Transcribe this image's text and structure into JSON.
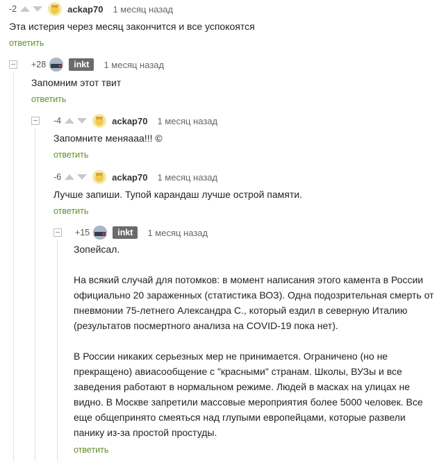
{
  "comments": [
    {
      "rating": "-2",
      "author": "ackap70",
      "time": "1 месяц назад",
      "text": "Эта истерия через месяц закончится и все успокоятся",
      "reply": "ответить"
    },
    {
      "rating": "+28",
      "author": "inkt",
      "time": "1 месяц назад",
      "text": "Запомним этот твит",
      "reply": "ответить"
    },
    {
      "rating": "-4",
      "author": "ackap70",
      "time": "1 месяц назад",
      "text": "Запомните меняааа!!! ©",
      "reply": "ответить"
    },
    {
      "rating": "-6",
      "author": "ackap70",
      "time": "1 месяц назад",
      "text": "Лучше запиши. Тупой карандаш лучше острой памяти.",
      "reply": "ответить"
    },
    {
      "rating": "+15",
      "author": "inkt",
      "time": "1 месяц назад",
      "lines": [
        "Зопейсал.",
        "",
        "На всякий случай для потомков: в момент написания этого камента в России",
        "официально 20 зараженных (статистика ВОЗ). Одна подозрительная смерть от",
        "пневмонии 75-летнего Александра С., который ездил в северную Италию",
        "(результатов посмертного анализа на COVID-19 пока нет).",
        "",
        "В России никаких серьезных мер не принимается. Ограничено (но не",
        "прекращено) авиасообщение с \"красными\" странам. Школы, ВУЗы и все",
        "заведения работают в нормальном режиме. Людей в масках на улицах не",
        "видно. В Москве запретили массовые мероприятия более 5000 человек. Все",
        "еще общепринято смеяться над глупыми европейцами, которые развели",
        "панику из-за простой простуды."
      ],
      "reply": "ответить"
    }
  ],
  "colors": {
    "reply_link": "#5f8f26",
    "badge_bg": "#6b6b6b",
    "arrow": "#c9c9c9"
  },
  "icons": {
    "upvote": "triangle-up-icon",
    "downvote": "triangle-down-icon",
    "collapse": "minus-square-icon"
  }
}
